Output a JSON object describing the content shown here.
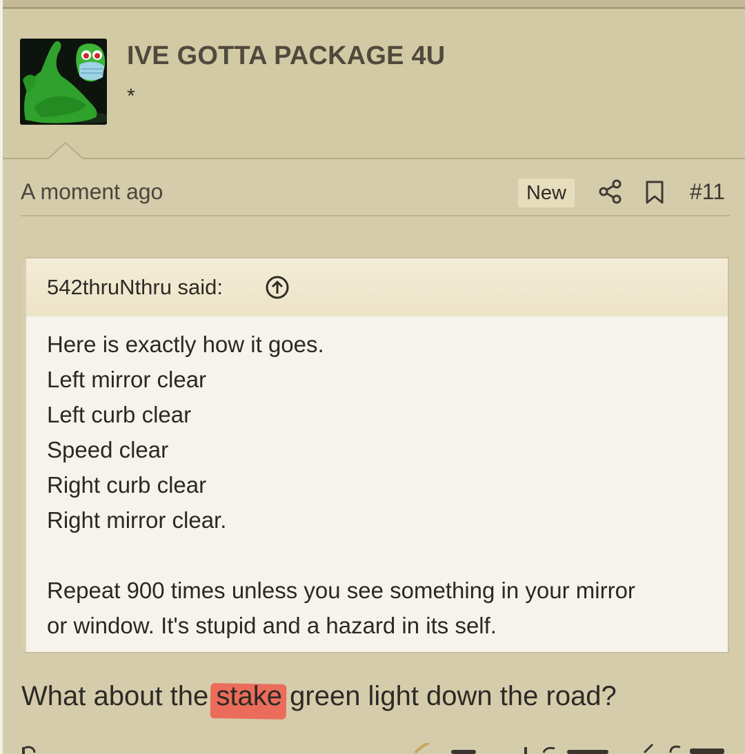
{
  "post": {
    "username": "IVE GOTTA PACKAGE 4U",
    "user_title": "*",
    "time": "A moment ago",
    "badge": "New",
    "post_number": "#11"
  },
  "quote": {
    "author": "542thruNthru said:",
    "lines": [
      "Here is exactly how it goes.",
      "Left mirror clear",
      "Left curb clear",
      "Speed clear",
      "Right curb clear",
      "Right mirror clear.",
      "",
      "Repeat 900 times unless you see something in your mirror",
      "or window. It's stupid and a hazard in its self."
    ]
  },
  "reply": {
    "before": "What about the ",
    "highlighted": "stake",
    "after": " green light down the road?"
  },
  "icons": {
    "share": "share-icon",
    "bookmark": "bookmark-icon",
    "quote_jump": "arrow-up-circle-icon",
    "avatar": "green-clay-figure-avatar"
  },
  "colors": {
    "page_bg": "#d5ccab",
    "header_bg": "#d2c9a5",
    "quote_bg": "#f6f3ec",
    "highlight": "#ee5a4b",
    "username": "#4f4a3c"
  }
}
